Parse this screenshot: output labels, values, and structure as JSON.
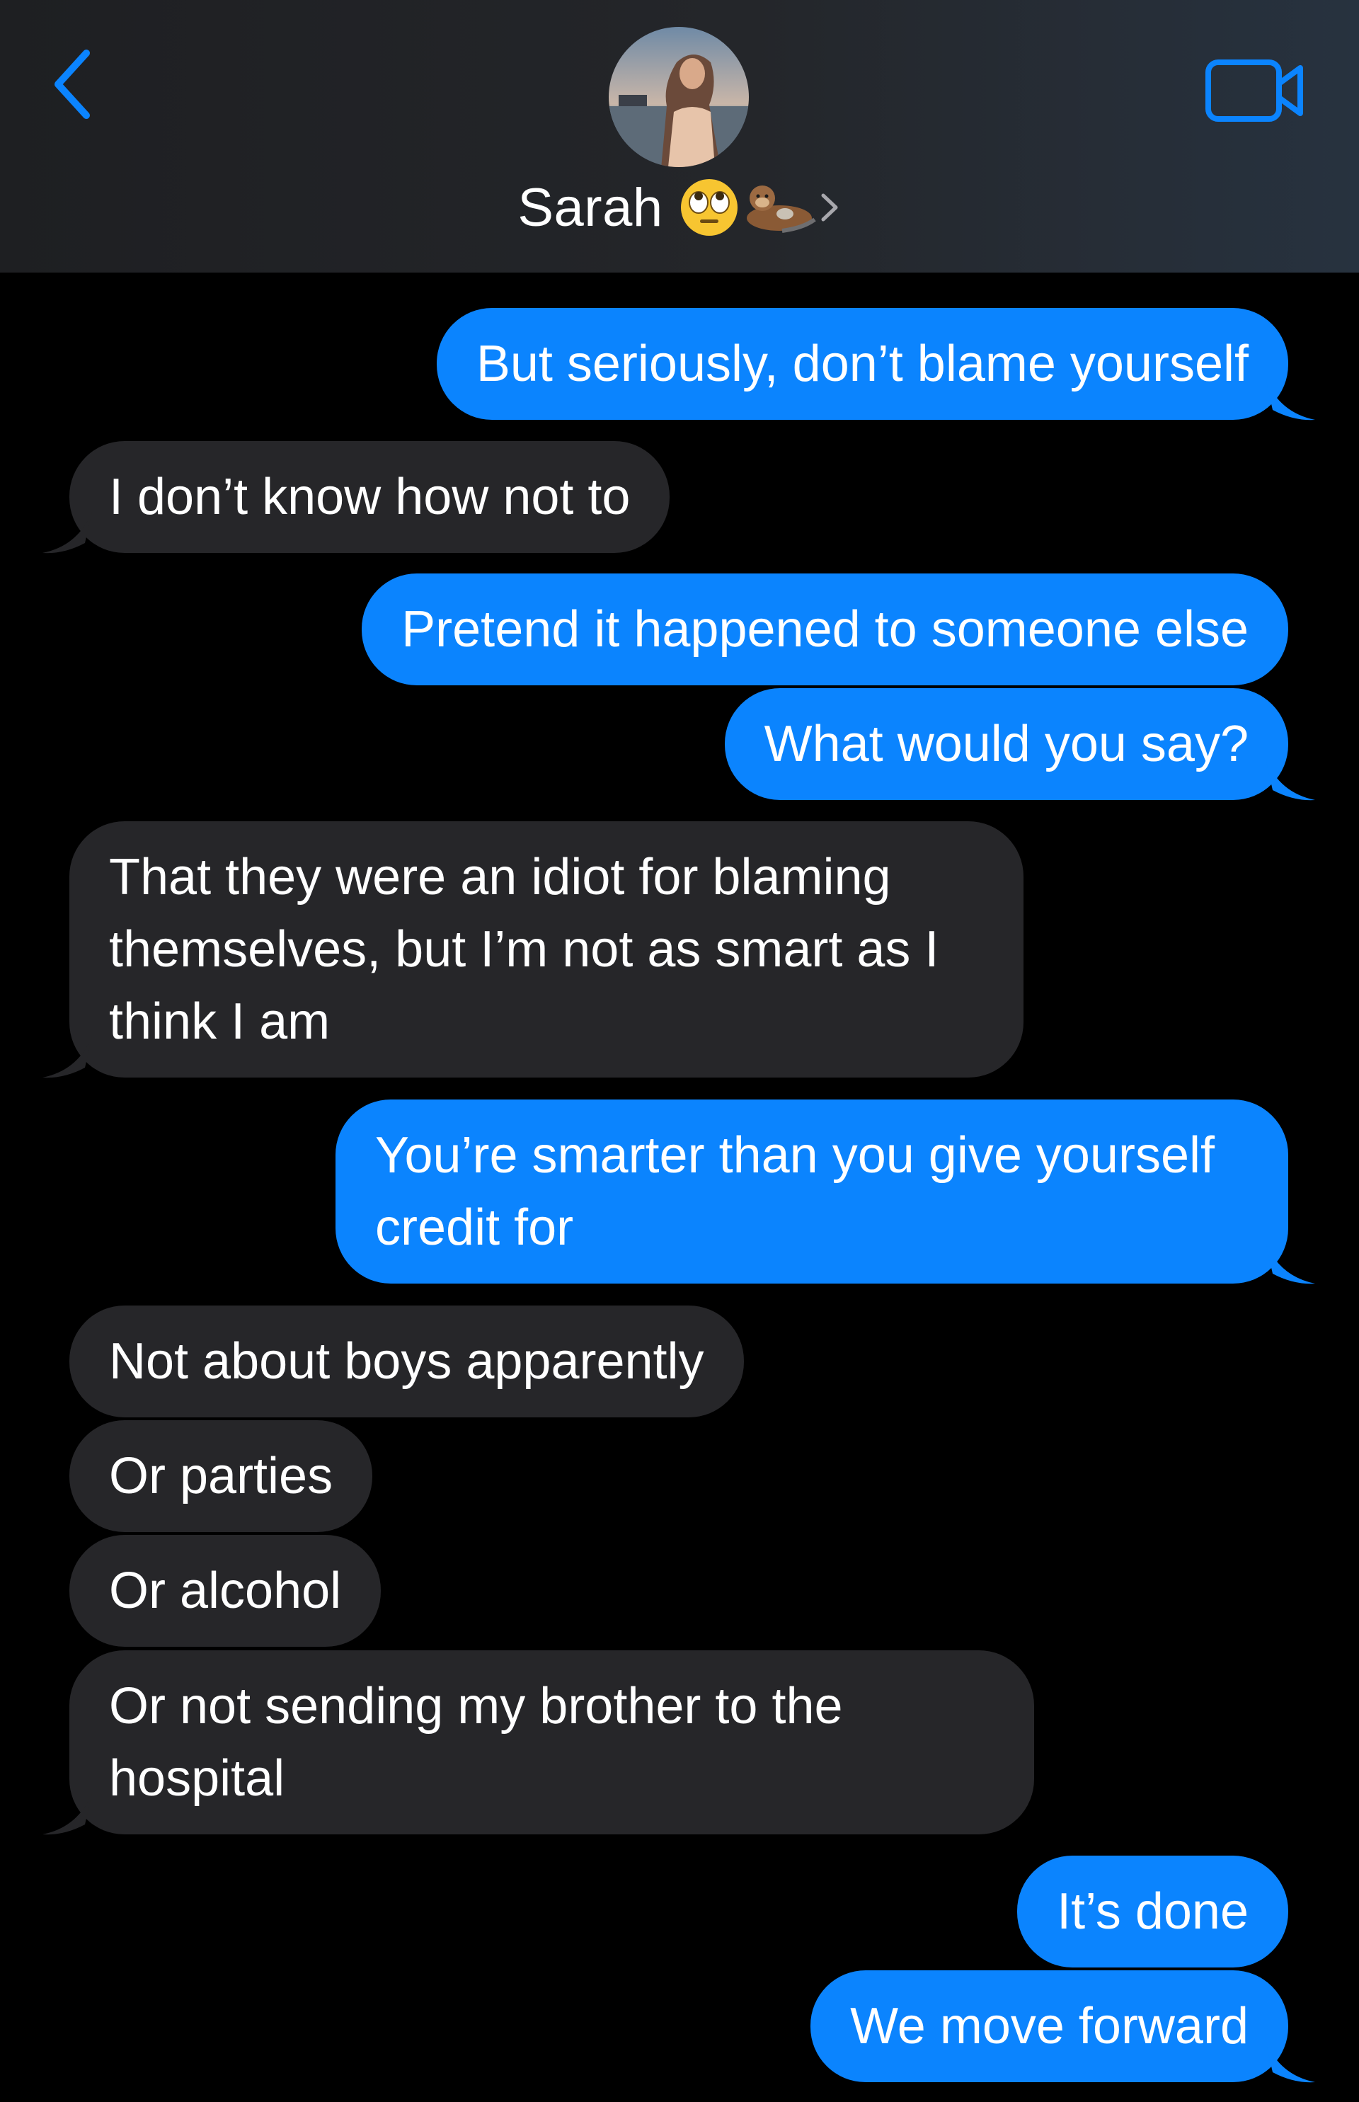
{
  "header": {
    "back_icon": "chevron-left-icon",
    "video_icon": "video-camera-icon",
    "contact_name": "Sarah",
    "name_emojis": [
      "face-with-rolling-eyes-icon",
      "otter-icon"
    ],
    "accent_color": "#0b84fe"
  },
  "messages": [
    {
      "direction": "sent",
      "lines": [
        "But seriously, don’t blame yourself"
      ]
    },
    {
      "direction": "received",
      "lines": [
        "I don’t know how not to"
      ]
    },
    {
      "direction": "sent",
      "lines": [
        "Pretend it happened to someone else"
      ]
    },
    {
      "direction": "sent",
      "lines": [
        "What would you say?"
      ]
    },
    {
      "direction": "received",
      "lines": [
        "That they were an idiot for blaming",
        "themselves, but I’m not as smart as I",
        "think I am"
      ]
    },
    {
      "direction": "sent",
      "lines": [
        "You’re smarter than you give yourself",
        "credit for"
      ]
    },
    {
      "direction": "received",
      "lines": [
        "Not about boys apparently"
      ]
    },
    {
      "direction": "received",
      "lines": [
        "Or parties"
      ]
    },
    {
      "direction": "received",
      "lines": [
        "Or alcohol"
      ]
    },
    {
      "direction": "received",
      "lines": [
        "Or not sending my brother to the",
        "hospital"
      ]
    },
    {
      "direction": "sent",
      "lines": [
        "It’s done"
      ]
    },
    {
      "direction": "sent",
      "lines": [
        "We move forward"
      ]
    }
  ],
  "colors": {
    "sent_bubble": "#0b84fe",
    "received_bubble": "#262629",
    "background": "#000000"
  }
}
